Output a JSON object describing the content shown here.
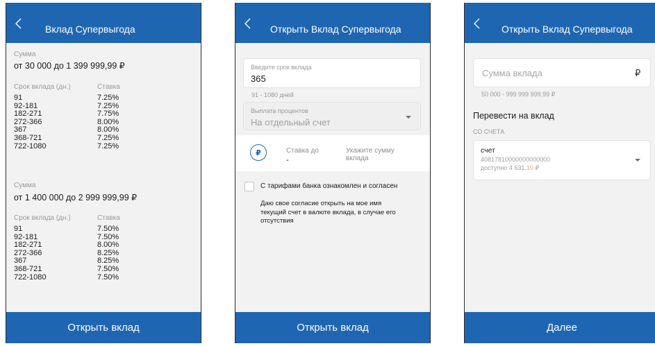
{
  "screen1": {
    "title": "Вклад Супервыгода",
    "tier1": {
      "sum_label": "Сумма",
      "sum_value": "от 30 000 до 1 399 999,99 ₽",
      "col_term": "Срок вклада (дн.)",
      "col_rate": "Ставка",
      "terms": [
        "91",
        "92-181",
        "182-271",
        "272-366",
        "367",
        "368-721",
        "722-1080"
      ],
      "rates": [
        "7.25%",
        "7.25%",
        "7.75%",
        "8.00%",
        "8.00%",
        "7.25%",
        "7.25%"
      ]
    },
    "tier2": {
      "sum_label": "Сумма",
      "sum_value": "от 1 400 000 до 2 999 999,99 ₽",
      "col_term": "Срок вклада (дн.)",
      "col_rate": "Ставка",
      "terms": [
        "91",
        "92-181",
        "182-271",
        "272-366",
        "367",
        "368-721",
        "722-1080"
      ],
      "rates": [
        "7.50%",
        "7.50%",
        "8.00%",
        "8.25%",
        "8.25%",
        "7.50%",
        "7.50%"
      ]
    },
    "footer_button": "Открыть вклад"
  },
  "screen2": {
    "title": "Открыть  Вклад Супервыгода",
    "term_field": {
      "label": "Введите срок вклада",
      "value": "365",
      "hint": "91 - 1080 дней"
    },
    "payout_field": {
      "label": "Выплата процентов",
      "value": "На отдельный счет"
    },
    "rate": {
      "currency_symbol": "₽",
      "label": "Ставка до",
      "value": "-",
      "prompt_line1": "Укажите сумму",
      "prompt_line2": "вклада"
    },
    "agree_checkbox": {
      "label": "С тарифами банка ознакомлен и согласен",
      "checked": false
    },
    "consent_text": [
      "Даю свое согласие открыть на мое имя",
      "текущий счет в валюте вклада, в случае его",
      "отсутствия"
    ],
    "footer_button": "Открыть вклад"
  },
  "screen3": {
    "title": "Открыть  Вклад Супервыгода",
    "amount_field": {
      "placeholder": "Сумма вклада",
      "currency": "₽",
      "hint": "50 000 - 999 999 999,99 ₽"
    },
    "transfer_title": "Перевести на вклад",
    "from_account_label": "СО СЧЕТА",
    "account": {
      "name": "счет",
      "number": "40817810000000000000",
      "available_prefix": "доступно 4 631,",
      "available_cents": "10",
      "available_currency": " ₽"
    },
    "footer_button": "Далее"
  },
  "colors": {
    "brand_blue": "#1f66b2",
    "background": "#f2f2f2",
    "muted_text": "#9a9a9a",
    "accent_orange": "#f0a868"
  },
  "icons": [
    "back-chevron-icon",
    "dropdown-caret-icon",
    "ruble-icon"
  ]
}
